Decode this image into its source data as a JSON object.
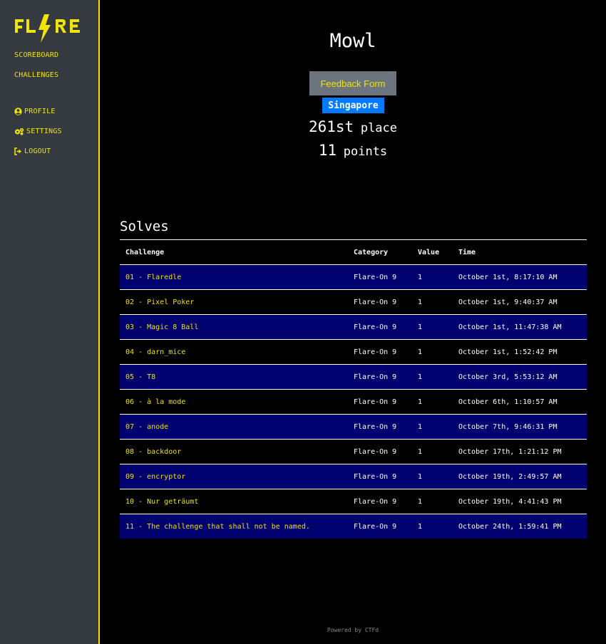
{
  "sidebar": {
    "logo_text": "FLARE",
    "nav_main": [
      {
        "label": "SCOREBOARD"
      },
      {
        "label": "CHALLENGES"
      }
    ],
    "nav_user": [
      {
        "label": "PROFILE",
        "icon": "user-circle-icon"
      },
      {
        "label": "SETTINGS",
        "icon": "cogs-icon"
      },
      {
        "label": "LOGOUT",
        "icon": "sign-out-icon"
      }
    ]
  },
  "team": {
    "name": "Mowl",
    "feedback_label": "Feedback Form",
    "country": "Singapore",
    "place_rank": "261st",
    "place_word": "place",
    "points_value": "11",
    "points_word": "points"
  },
  "solves": {
    "title": "Solves",
    "headers": [
      "Challenge",
      "Category",
      "Value",
      "Time"
    ],
    "rows": [
      {
        "challenge": "01 - Flaredle",
        "category": "Flare-On 9",
        "value": "1",
        "time": "October 1st, 8:17:10 AM"
      },
      {
        "challenge": "02 - Pixel Poker",
        "category": "Flare-On 9",
        "value": "1",
        "time": "October 1st, 9:40:37 AM"
      },
      {
        "challenge": "03 - Magic 8 Ball",
        "category": "Flare-On 9",
        "value": "1",
        "time": "October 1st, 11:47:38 AM"
      },
      {
        "challenge": "04 - darn_mice",
        "category": "Flare-On 9",
        "value": "1",
        "time": "October 1st, 1:52:42 PM"
      },
      {
        "challenge": "05 - T8",
        "category": "Flare-On 9",
        "value": "1",
        "time": "October 3rd, 5:53:12 AM"
      },
      {
        "challenge": "06 - à la mode",
        "category": "Flare-On 9",
        "value": "1",
        "time": "October 6th, 1:10:57 AM"
      },
      {
        "challenge": "07 - anode",
        "category": "Flare-On 9",
        "value": "1",
        "time": "October 7th, 9:46:31 PM"
      },
      {
        "challenge": "08 - backdoor",
        "category": "Flare-On 9",
        "value": "1",
        "time": "October 17th, 1:21:12 PM"
      },
      {
        "challenge": "09 - encryptor",
        "category": "Flare-On 9",
        "value": "1",
        "time": "October 19th, 2:49:57 AM"
      },
      {
        "challenge": "10 - Nur geträumt",
        "category": "Flare-On 9",
        "value": "1",
        "time": "October 19th, 4:41:43 PM"
      },
      {
        "challenge": "11 - The challenge that shall not be named.",
        "category": "Flare-On 9",
        "value": "1",
        "time": "October 24th, 1:59:41 PM"
      }
    ]
  },
  "footer": {
    "text": "Powered by CTFd"
  },
  "colors": {
    "accent": "#f0e400",
    "sidebar_bg": "#343a40",
    "row_odd": "#00006e",
    "badge": "#007bff",
    "button": "#6c757d"
  }
}
